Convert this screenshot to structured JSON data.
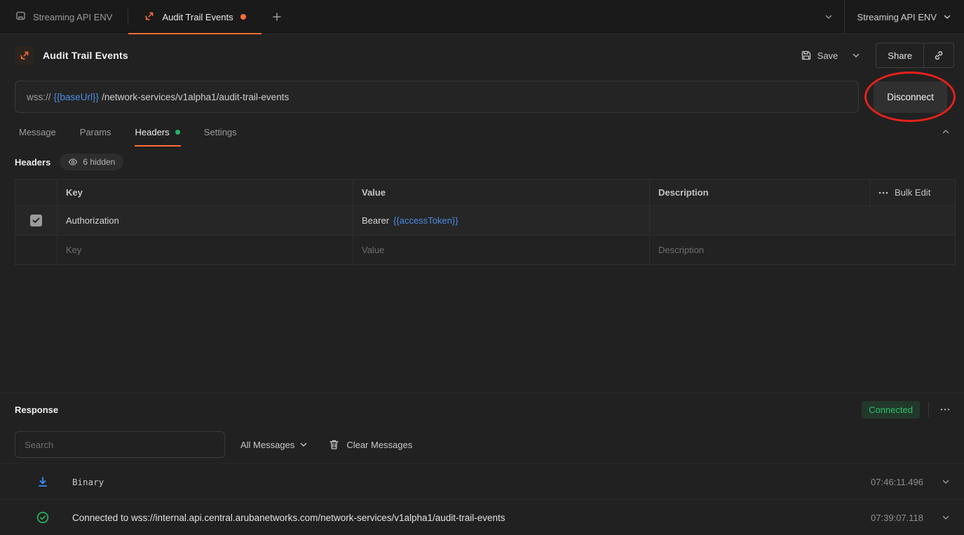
{
  "colors": {
    "accent_orange": "#ff6c37",
    "variable_blue": "#4b8de4",
    "success_green": "#2fc06c",
    "annotation_red": "#e5211b",
    "background": "#212121"
  },
  "topbar": {
    "env_tab_label": "Streaming API ENV",
    "active_tab_label": "Audit Trail Events",
    "env_selector_label": "Streaming API ENV"
  },
  "header": {
    "title": "Audit Trail Events",
    "save_label": "Save",
    "share_label": "Share"
  },
  "url_bar": {
    "scheme": "wss://",
    "variable": "{{baseUrl}}",
    "path": "/network-services/v1alpha1/audit-trail-events",
    "disconnect_label": "Disconnect"
  },
  "request_tabs": {
    "message": "Message",
    "params": "Params",
    "headers": "Headers",
    "settings": "Settings"
  },
  "headers_section": {
    "title": "Headers",
    "hidden_label": "6 hidden",
    "columns": {
      "key": "Key",
      "value": "Value",
      "description": "Description"
    },
    "bulk_edit_label": "Bulk Edit",
    "row": {
      "key": "Authorization",
      "value_prefix": "Bearer",
      "value_variable": "{{accessToken}}",
      "description": ""
    },
    "placeholder_row": {
      "key": "Key",
      "value": "Value",
      "description": "Description"
    }
  },
  "response": {
    "title": "Response",
    "status": "Connected",
    "search_placeholder": "Search",
    "filter_label": "All Messages",
    "clear_label": "Clear Messages",
    "messages": [
      {
        "kind": "binary-received",
        "text": "Binary",
        "time": "07:46:11.496"
      },
      {
        "kind": "connected",
        "text": "Connected to wss://internal.api.central.arubanetworks.com/network-services/v1alpha1/audit-trail-events",
        "time": "07:39:07.118"
      }
    ]
  }
}
